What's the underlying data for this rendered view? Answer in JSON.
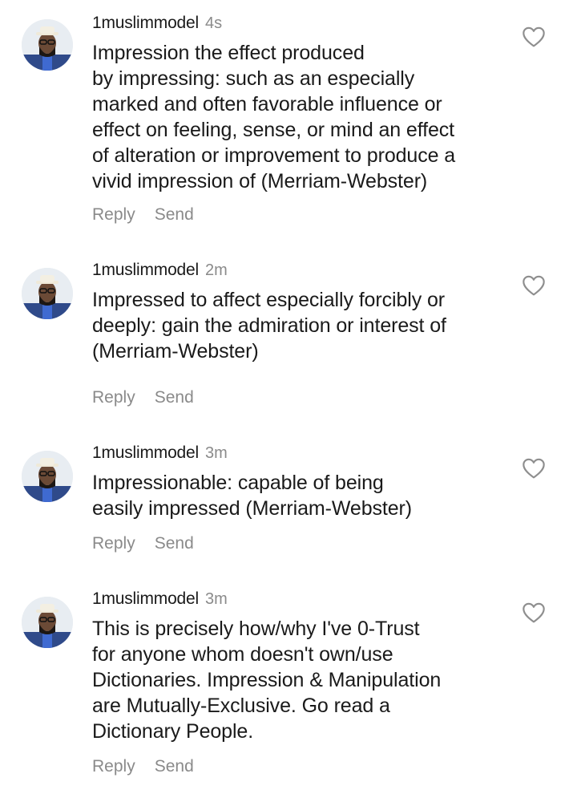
{
  "comments": [
    {
      "username": "1muslimmodel",
      "time": "4s",
      "lines": [
        "Impression the effect produced",
        "by impressing: such as an especially",
        "marked and often favorable influence or",
        "effect on feeling, sense, or mind an effect",
        "of alteration or improvement to produce a",
        "vivid impression of (Merriam-Webster)"
      ],
      "reply_label": "Reply",
      "send_label": "Send"
    },
    {
      "username": "1muslimmodel",
      "time": "2m",
      "lines": [
        "Impressed to affect especially forcibly or",
        "deeply: gain the admiration or interest of",
        "(Merriam-Webster)"
      ],
      "reply_label": "Reply",
      "send_label": "Send"
    },
    {
      "username": "1muslimmodel",
      "time": "3m",
      "lines": [
        "Impressionable: capable of being",
        "easily impressed (Merriam-Webster)"
      ],
      "reply_label": "Reply",
      "send_label": "Send"
    },
    {
      "username": "1muslimmodel",
      "time": "3m",
      "lines": [
        "This is precisely how/why I've 0-Trust",
        "for anyone whom doesn't own/use",
        "Dictionaries. Impression & Manipulation",
        "are Mutually-Exclusive. Go read a",
        "Dictionary People."
      ],
      "reply_label": "Reply",
      "send_label": "Send"
    }
  ],
  "icons": {
    "like": "heart-outline-icon",
    "avatar": "profile-avatar"
  },
  "colors": {
    "text": "#1a1a1a",
    "muted": "#8a8a8a",
    "icon": "#8e8e8e",
    "background": "#ffffff"
  }
}
